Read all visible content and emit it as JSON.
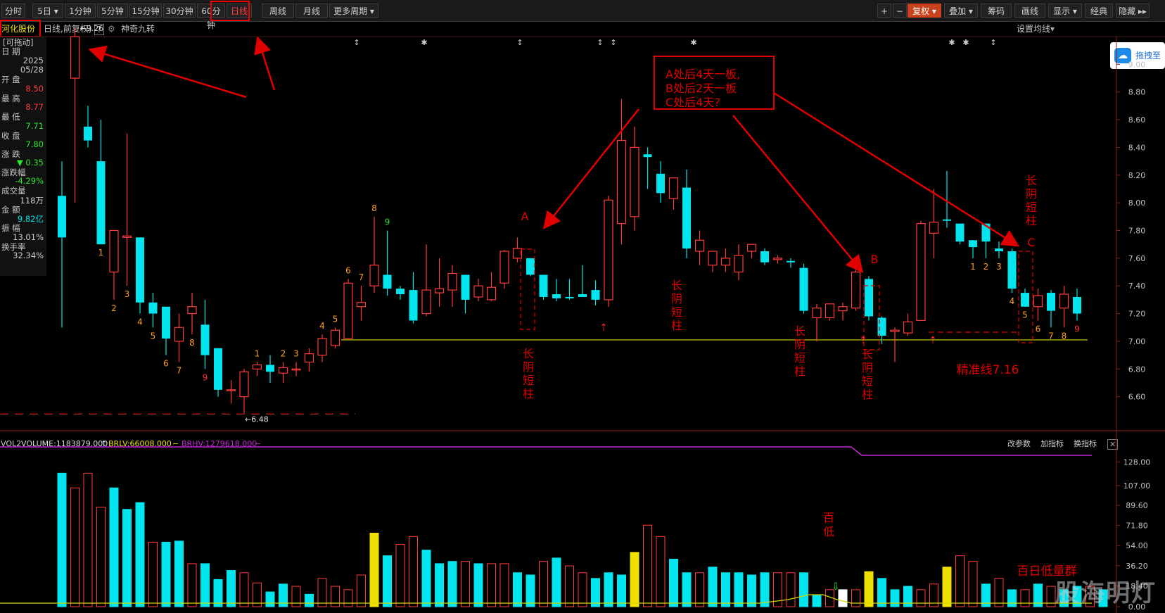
{
  "toolbar": {
    "periods": [
      "分时",
      "5日",
      "1分钟",
      "5分钟",
      "15分钟",
      "30分钟",
      "60分钟",
      "日线",
      "周线",
      "月线",
      "更多周期"
    ],
    "active_period": "日线",
    "right": {
      "plus": "+",
      "minus": "−",
      "fuquan": "复权",
      "diejia": "叠加",
      "chouma": "筹码",
      "huaxian": "画线",
      "xianshi": "显示",
      "jingdian": "经典",
      "yincang": "隐藏"
    }
  },
  "subbar": {
    "stock_name": "河化股份",
    "period_label": "日线,前复权)",
    "help": "?",
    "indicator": "神奇九转",
    "setting": "设置均线"
  },
  "floating_button": "拖拽至",
  "info_panel": {
    "drag_hint": "[可拖动]",
    "date_label": "日 期",
    "year": "2025",
    "date": "05/28",
    "open_label": "开 盘",
    "open": "8.50",
    "high_label": "最 高",
    "high": "8.77",
    "low_label": "最 低",
    "low": "7.71",
    "close_label": "收 盘",
    "close": "7.80",
    "change_label": "涨 跌",
    "change": "▼ 0.35",
    "pct_label": "涨跌幅",
    "pct": "-4.29%",
    "vol_label": "成交量",
    "vol": "118万",
    "amount_label": "金 额",
    "amount": "9.82亿",
    "amp_label": "振 幅",
    "amp": "13.01%",
    "turnover_label": "换手率",
    "turnover": "32.34%"
  },
  "volume_legend": {
    "name": "VOL2",
    "volume": "VOLUME:1183879.000",
    "brlv": "BRLV:66008.000",
    "brhv": "BRHV:1279618.000",
    "actions": [
      "改参数",
      "加指标",
      "换指标"
    ],
    "close": "✕"
  },
  "colors": {
    "up": "#ff3b3b",
    "down": "#00e5ee",
    "ma": "#d8d800",
    "brhv": "#c026d3",
    "annot": "#e00000",
    "highlight": "#f0e000"
  },
  "watermark": "股海明灯",
  "chart_data": [
    {
      "type": "candlestick",
      "price_ylim": [
        6.4,
        9.2
      ],
      "y_ticks": [
        "9.00",
        "8.80",
        "8.60",
        "8.40",
        "8.20",
        "8.00",
        "7.80",
        "7.60",
        "7.40",
        "7.20",
        "7.00",
        "6.80",
        "6.60"
      ],
      "candles": [
        {
          "o": 8.05,
          "h": 8.3,
          "l": 7.1,
          "c": 7.75
        },
        {
          "o": 8.9,
          "h": 9.26,
          "l": 8.0,
          "c": 9.2
        },
        {
          "o": 8.55,
          "h": 8.7,
          "l": 8.4,
          "c": 8.45
        },
        {
          "o": 8.3,
          "h": 8.6,
          "l": 7.7,
          "c": 7.7
        },
        {
          "o": 7.5,
          "h": 7.75,
          "l": 7.3,
          "c": 7.8
        },
        {
          "o": 7.75,
          "h": 8.5,
          "l": 7.4,
          "c": 7.76
        },
        {
          "o": 7.75,
          "h": 7.75,
          "l": 7.2,
          "c": 7.28
        },
        {
          "o": 7.28,
          "h": 7.35,
          "l": 7.1,
          "c": 7.2
        },
        {
          "o": 7.25,
          "h": 7.25,
          "l": 6.9,
          "c": 7.02
        },
        {
          "o": 7.0,
          "h": 7.2,
          "l": 6.85,
          "c": 7.1
        },
        {
          "o": 7.2,
          "h": 7.35,
          "l": 7.05,
          "c": 7.25
        },
        {
          "o": 7.12,
          "h": 7.3,
          "l": 6.8,
          "c": 6.9
        },
        {
          "o": 6.95,
          "h": 6.95,
          "l": 6.6,
          "c": 6.65
        },
        {
          "o": 6.65,
          "h": 6.72,
          "l": 6.55,
          "c": 6.65
        },
        {
          "o": 6.6,
          "h": 6.8,
          "l": 6.48,
          "c": 6.78
        },
        {
          "o": 6.8,
          "h": 6.85,
          "l": 6.75,
          "c": 6.83
        },
        {
          "o": 6.83,
          "h": 6.9,
          "l": 6.7,
          "c": 6.78
        },
        {
          "o": 6.77,
          "h": 6.85,
          "l": 6.7,
          "c": 6.81
        },
        {
          "o": 6.8,
          "h": 6.85,
          "l": 6.75,
          "c": 6.8
        },
        {
          "o": 6.85,
          "h": 6.95,
          "l": 6.78,
          "c": 6.91
        },
        {
          "o": 6.9,
          "h": 7.05,
          "l": 6.85,
          "c": 7.02
        },
        {
          "o": 6.97,
          "h": 7.1,
          "l": 6.95,
          "c": 7.08
        },
        {
          "o": 7.02,
          "h": 7.45,
          "l": 7.02,
          "c": 7.42
        },
        {
          "o": 7.25,
          "h": 7.4,
          "l": 7.15,
          "c": 7.28
        },
        {
          "o": 7.4,
          "h": 7.9,
          "l": 7.35,
          "c": 7.55
        },
        {
          "o": 7.48,
          "h": 7.8,
          "l": 7.33,
          "c": 7.38
        },
        {
          "o": 7.38,
          "h": 7.4,
          "l": 7.3,
          "c": 7.34
        },
        {
          "o": 7.37,
          "h": 7.5,
          "l": 7.13,
          "c": 7.15
        },
        {
          "o": 7.2,
          "h": 7.7,
          "l": 7.18,
          "c": 7.37
        },
        {
          "o": 7.35,
          "h": 7.6,
          "l": 7.25,
          "c": 7.38
        },
        {
          "o": 7.37,
          "h": 7.55,
          "l": 7.25,
          "c": 7.49
        },
        {
          "o": 7.48,
          "h": 7.48,
          "l": 7.2,
          "c": 7.3
        },
        {
          "o": 7.32,
          "h": 7.45,
          "l": 7.29,
          "c": 7.4
        },
        {
          "o": 7.3,
          "h": 7.5,
          "l": 7.29,
          "c": 7.39
        },
        {
          "o": 7.42,
          "h": 7.66,
          "l": 7.38,
          "c": 7.65
        },
        {
          "o": 7.6,
          "h": 7.75,
          "l": 7.57,
          "c": 7.67
        },
        {
          "o": 7.6,
          "h": 7.6,
          "l": 7.47,
          "c": 7.48
        },
        {
          "o": 7.48,
          "h": 7.48,
          "l": 7.3,
          "c": 7.32
        },
        {
          "o": 7.34,
          "h": 7.45,
          "l": 7.29,
          "c": 7.31
        },
        {
          "o": 7.32,
          "h": 7.45,
          "l": 7.3,
          "c": 7.31
        },
        {
          "o": 7.34,
          "h": 7.55,
          "l": 7.33,
          "c": 7.32
        },
        {
          "o": 7.37,
          "h": 7.44,
          "l": 7.26,
          "c": 7.3
        },
        {
          "o": 7.3,
          "h": 8.05,
          "l": 7.25,
          "c": 8.02
        },
        {
          "o": 7.85,
          "h": 8.75,
          "l": 7.7,
          "c": 8.45
        },
        {
          "o": 7.9,
          "h": 8.55,
          "l": 7.8,
          "c": 8.4
        },
        {
          "o": 8.35,
          "h": 8.4,
          "l": 8.1,
          "c": 8.33
        },
        {
          "o": 8.21,
          "h": 8.3,
          "l": 8.0,
          "c": 8.07
        },
        {
          "o": 8.03,
          "h": 8.17,
          "l": 7.95,
          "c": 8.18
        },
        {
          "o": 8.11,
          "h": 8.24,
          "l": 7.6,
          "c": 7.67
        },
        {
          "o": 7.65,
          "h": 7.8,
          "l": 7.55,
          "c": 7.73
        },
        {
          "o": 7.55,
          "h": 7.65,
          "l": 7.5,
          "c": 7.65
        },
        {
          "o": 7.55,
          "h": 7.67,
          "l": 7.5,
          "c": 7.6
        },
        {
          "o": 7.5,
          "h": 7.7,
          "l": 7.44,
          "c": 7.62
        },
        {
          "o": 7.65,
          "h": 7.7,
          "l": 7.6,
          "c": 7.7
        },
        {
          "o": 7.65,
          "h": 7.67,
          "l": 7.55,
          "c": 7.57
        },
        {
          "o": 7.59,
          "h": 7.62,
          "l": 7.56,
          "c": 7.6
        },
        {
          "o": 7.58,
          "h": 7.6,
          "l": 7.53,
          "c": 7.57
        },
        {
          "o": 7.53,
          "h": 7.56,
          "l": 7.2,
          "c": 7.22
        },
        {
          "o": 7.17,
          "h": 7.27,
          "l": 7.0,
          "c": 7.24
        },
        {
          "o": 7.17,
          "h": 7.26,
          "l": 7.15,
          "c": 7.27
        },
        {
          "o": 7.22,
          "h": 7.28,
          "l": 7.15,
          "c": 7.25
        },
        {
          "o": 7.24,
          "h": 7.6,
          "l": 7.22,
          "c": 7.5
        },
        {
          "o": 7.45,
          "h": 7.47,
          "l": 7.15,
          "c": 7.18
        },
        {
          "o": 7.17,
          "h": 7.18,
          "l": 6.98,
          "c": 7.04
        },
        {
          "o": 7.07,
          "h": 7.1,
          "l": 6.85,
          "c": 7.08
        },
        {
          "o": 7.06,
          "h": 7.2,
          "l": 7.04,
          "c": 7.14
        },
        {
          "o": 7.15,
          "h": 7.87,
          "l": 7.15,
          "c": 7.85
        },
        {
          "o": 7.78,
          "h": 8.1,
          "l": 7.6,
          "c": 7.86
        },
        {
          "o": 7.88,
          "h": 8.23,
          "l": 7.82,
          "c": 7.87
        },
        {
          "o": 7.85,
          "h": 7.85,
          "l": 7.7,
          "c": 7.72
        },
        {
          "o": 7.73,
          "h": 7.73,
          "l": 7.6,
          "c": 7.68
        },
        {
          "o": 7.85,
          "h": 7.85,
          "l": 7.6,
          "c": 7.72
        },
        {
          "o": 7.67,
          "h": 7.72,
          "l": 7.6,
          "c": 7.65
        },
        {
          "o": 7.65,
          "h": 7.67,
          "l": 7.35,
          "c": 7.38
        },
        {
          "o": 7.35,
          "h": 7.38,
          "l": 7.25,
          "c": 7.25
        },
        {
          "o": 7.25,
          "h": 7.38,
          "l": 7.15,
          "c": 7.33
        },
        {
          "o": 7.35,
          "h": 7.37,
          "l": 7.1,
          "c": 7.22
        },
        {
          "o": 7.24,
          "h": 7.4,
          "l": 7.1,
          "c": 7.34
        },
        {
          "o": 7.32,
          "h": 7.38,
          "l": 7.15,
          "c": 7.2
        }
      ],
      "turn_counts": [
        {
          "i": 3,
          "n": "1",
          "c": "orange"
        },
        {
          "i": 4,
          "n": "2",
          "c": "orange"
        },
        {
          "i": 5,
          "n": "3",
          "c": "orange"
        },
        {
          "i": 6,
          "n": "4",
          "c": "orange"
        },
        {
          "i": 7,
          "n": "5",
          "c": "orange"
        },
        {
          "i": 8,
          "n": "6",
          "c": "orange"
        },
        {
          "i": 9,
          "n": "7",
          "c": "orange"
        },
        {
          "i": 10,
          "n": "8",
          "c": "orange"
        },
        {
          "i": 11,
          "n": "9",
          "c": "red"
        },
        {
          "i": 15,
          "n": "1",
          "c": "orange"
        },
        {
          "i": 17,
          "n": "2",
          "c": "orange"
        },
        {
          "i": 18,
          "n": "3",
          "c": "orange"
        },
        {
          "i": 20,
          "n": "4",
          "c": "orange"
        },
        {
          "i": 21,
          "n": "5",
          "c": "orange"
        },
        {
          "i": 22,
          "n": "6",
          "c": "orange"
        },
        {
          "i": 23,
          "n": "7",
          "c": "orange"
        },
        {
          "i": 24,
          "n": "8",
          "c": "orange"
        },
        {
          "i": 25,
          "n": "9",
          "c": "green"
        },
        {
          "i": 70,
          "n": "1",
          "c": "orange"
        },
        {
          "i": 71,
          "n": "2",
          "c": "orange"
        },
        {
          "i": 72,
          "n": "3",
          "c": "orange"
        },
        {
          "i": 73,
          "n": "4",
          "c": "orange"
        },
        {
          "i": 74,
          "n": "5",
          "c": "orange"
        },
        {
          "i": 75,
          "n": "6",
          "c": "orange"
        },
        {
          "i": 76,
          "n": "7",
          "c": "orange"
        },
        {
          "i": 77,
          "n": "8",
          "c": "orange"
        },
        {
          "i": 78,
          "n": "9",
          "c": "red"
        }
      ],
      "high_marker": "9.26",
      "low_marker": "6.48",
      "precision_line": {
        "value": 7.01,
        "label": "精准线7.16"
      },
      "annotation_box": [
        "A处后4天一板,",
        "B处后2天一板",
        "C处后4天?"
      ],
      "labels": {
        "A": "A",
        "B": "B",
        "C": "C",
        "long_yin_1": [
          "长",
          "阴",
          "短",
          "柱"
        ],
        "long_yin_2": [
          "长",
          "阴",
          "短",
          "柱"
        ],
        "long_yin_3": [
          "长",
          "阴",
          "短",
          "柱"
        ],
        "long_yin_4": [
          "长",
          "阴",
          "短",
          "柱"
        ],
        "long_yin_5": [
          "长",
          "阴",
          "短",
          "柱"
        ],
        "bai_di": [
          "百",
          "低"
        ],
        "bai_ri_di": "百日低量群"
      },
      "top_markers": [
        "↕",
        "✱",
        "↕",
        "↕",
        "↕",
        "✱",
        "✱",
        "✱",
        "↕"
      ]
    },
    {
      "type": "bar",
      "series": "volume",
      "ylim": [
        0,
        135
      ],
      "y_ticks": [
        "128.00",
        "107.00",
        "89.60",
        "71.80",
        "54.00",
        "36.20",
        "18.40",
        "0.00"
      ],
      "values": [
        {
          "v": 118,
          "d": "dn"
        },
        {
          "v": 105,
          "d": "up"
        },
        {
          "v": 118,
          "d": "up"
        },
        {
          "v": 88,
          "d": "up"
        },
        {
          "v": 105,
          "d": "dn"
        },
        {
          "v": 86,
          "d": "dn"
        },
        {
          "v": 92,
          "d": "dn"
        },
        {
          "v": 57,
          "d": "up"
        },
        {
          "v": 57,
          "d": "dn"
        },
        {
          "v": 58,
          "d": "dn"
        },
        {
          "v": 38,
          "d": "up"
        },
        {
          "v": 38,
          "d": "dn"
        },
        {
          "v": 24,
          "d": "dn"
        },
        {
          "v": 32,
          "d": "dn"
        },
        {
          "v": 30,
          "d": "up"
        },
        {
          "v": 21,
          "d": "up"
        },
        {
          "v": 13,
          "d": "dn"
        },
        {
          "v": 20,
          "d": "dn"
        },
        {
          "v": 18,
          "d": "up"
        },
        {
          "v": 11,
          "d": "dn"
        },
        {
          "v": 25,
          "d": "up"
        },
        {
          "v": 18,
          "d": "up"
        },
        {
          "v": 15,
          "d": "up"
        },
        {
          "v": 28,
          "d": "up"
        },
        {
          "v": 65,
          "d": "hl"
        },
        {
          "v": 45,
          "d": "dn"
        },
        {
          "v": 55,
          "d": "up"
        },
        {
          "v": 62,
          "d": "up"
        },
        {
          "v": 50,
          "d": "dn"
        },
        {
          "v": 38,
          "d": "dn"
        },
        {
          "v": 40,
          "d": "dn"
        },
        {
          "v": 40,
          "d": "up"
        },
        {
          "v": 38,
          "d": "dn"
        },
        {
          "v": 38,
          "d": "up"
        },
        {
          "v": 38,
          "d": "up"
        },
        {
          "v": 30,
          "d": "dn"
        },
        {
          "v": 28,
          "d": "dn"
        },
        {
          "v": 40,
          "d": "up"
        },
        {
          "v": 43,
          "d": "dn"
        },
        {
          "v": 36,
          "d": "up"
        },
        {
          "v": 30,
          "d": "up"
        },
        {
          "v": 25,
          "d": "dn"
        },
        {
          "v": 30,
          "d": "dn"
        },
        {
          "v": 28,
          "d": "dn"
        },
        {
          "v": 48,
          "d": "hl"
        },
        {
          "v": 72,
          "d": "up"
        },
        {
          "v": 62,
          "d": "up"
        },
        {
          "v": 42,
          "d": "dn"
        },
        {
          "v": 30,
          "d": "dn"
        },
        {
          "v": 30,
          "d": "up"
        },
        {
          "v": 35,
          "d": "dn"
        },
        {
          "v": 30,
          "d": "dn"
        },
        {
          "v": 30,
          "d": "dn"
        },
        {
          "v": 28,
          "d": "dn"
        },
        {
          "v": 30,
          "d": "dn"
        },
        {
          "v": 30,
          "d": "up"
        },
        {
          "v": 30,
          "d": "up"
        },
        {
          "v": 30,
          "d": "dn"
        },
        {
          "v": 10,
          "d": "dn"
        },
        {
          "v": 15,
          "d": "up"
        },
        {
          "v": 15,
          "d": "wh"
        },
        {
          "v": 15,
          "d": "up"
        },
        {
          "v": 31,
          "d": "hl"
        },
        {
          "v": 25,
          "d": "dn"
        },
        {
          "v": 15,
          "d": "dn"
        },
        {
          "v": 18,
          "d": "dn"
        },
        {
          "v": 15,
          "d": "up"
        },
        {
          "v": 20,
          "d": "up"
        },
        {
          "v": 35,
          "d": "hl"
        },
        {
          "v": 45,
          "d": "up"
        },
        {
          "v": 40,
          "d": "up"
        },
        {
          "v": 20,
          "d": "dn"
        },
        {
          "v": 25,
          "d": "up"
        },
        {
          "v": 15,
          "d": "dn"
        },
        {
          "v": 15,
          "d": "up"
        },
        {
          "v": 20,
          "d": "dn"
        },
        {
          "v": 18,
          "d": "up"
        },
        {
          "v": 15,
          "d": "dn"
        },
        {
          "v": 18,
          "d": "dn"
        },
        {
          "v": 18,
          "d": "up"
        },
        {
          "v": 15,
          "d": "dn"
        }
      ]
    }
  ]
}
